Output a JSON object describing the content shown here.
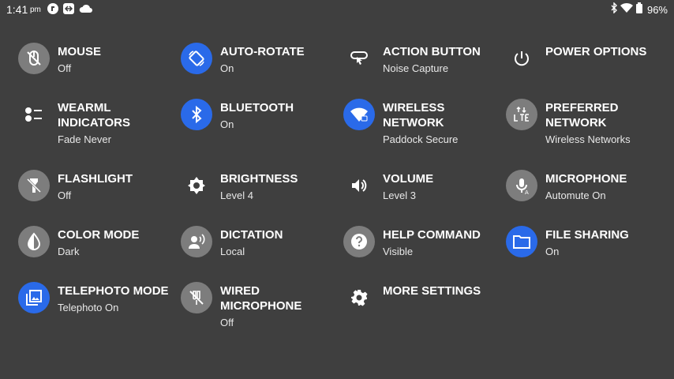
{
  "status_bar": {
    "time": "1:41",
    "ampm": "pm",
    "battery": "96%"
  },
  "tiles": [
    {
      "label": "MOUSE",
      "sub": "Off",
      "icon": "mouse-off-icon",
      "style": "gray"
    },
    {
      "label": "AUTO-ROTATE",
      "sub": "On",
      "icon": "screen-rotation-icon",
      "style": "blue"
    },
    {
      "label": "ACTION BUTTON",
      "sub": "Noise Capture",
      "icon": "action-button-icon",
      "style": "none"
    },
    {
      "label": "POWER OPTIONS",
      "sub": "",
      "icon": "power-icon",
      "style": "none"
    },
    {
      "label": "WEARML INDICATORS",
      "sub": "Fade Never",
      "icon": "numbered-list-icon",
      "style": "none"
    },
    {
      "label": "BLUETOOTH",
      "sub": "On",
      "icon": "bluetooth-icon",
      "style": "blue"
    },
    {
      "label": "WIRELESS NETWORK",
      "sub": "Paddock Secure",
      "icon": "wifi-lock-icon",
      "style": "blue"
    },
    {
      "label": "PREFERRED NETWORK",
      "sub": "Wireless Networks",
      "icon": "lte-icon",
      "style": "gray"
    },
    {
      "label": "FLASHLIGHT",
      "sub": "Off",
      "icon": "flashlight-off-icon",
      "style": "gray"
    },
    {
      "label": "BRIGHTNESS",
      "sub": "Level 4",
      "icon": "brightness-icon",
      "style": "none"
    },
    {
      "label": "VOLUME",
      "sub": "Level 3",
      "icon": "volume-icon",
      "style": "none"
    },
    {
      "label": "MICROPHONE",
      "sub": "Automute On",
      "icon": "microphone-auto-icon",
      "style": "gray"
    },
    {
      "label": "COLOR MODE",
      "sub": "Dark",
      "icon": "color-mode-icon",
      "style": "gray"
    },
    {
      "label": "DICTATION",
      "sub": "Local",
      "icon": "dictation-icon",
      "style": "gray"
    },
    {
      "label": "HELP COMMAND",
      "sub": "Visible",
      "icon": "help-icon",
      "style": "gray"
    },
    {
      "label": "FILE SHARING",
      "sub": "On",
      "icon": "folder-icon",
      "style": "blue"
    },
    {
      "label": "TELEPHOTO MODE",
      "sub": "Telephoto On",
      "icon": "photo-library-icon",
      "style": "blue"
    },
    {
      "label": "WIRED MICROPHONE",
      "sub": "Off",
      "icon": "wired-mic-off-icon",
      "style": "gray"
    },
    {
      "label": "MORE SETTINGS",
      "sub": "",
      "icon": "settings-gear-icon",
      "style": "none"
    }
  ],
  "colors": {
    "background": "#3f3f3f",
    "active": "#2a6ae9",
    "inactive": "#7d7d7d"
  }
}
